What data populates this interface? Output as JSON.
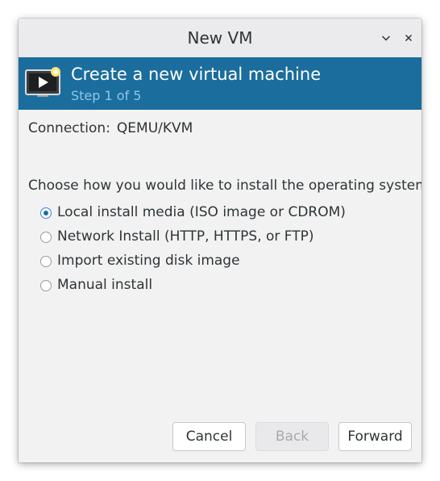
{
  "window": {
    "title": "New VM"
  },
  "titlebar": {
    "minimize_icon": "chevron-down-icon",
    "close_icon": "close-icon"
  },
  "banner": {
    "icon": "vm-monitor-icon",
    "title": "Create a new virtual machine",
    "step": "Step 1 of 5",
    "background_color": "#1b6d9d",
    "step_color": "#8cc6ea"
  },
  "connection": {
    "label": "Connection:",
    "value": "QEMU/KVM"
  },
  "install": {
    "prompt": "Choose how you would like to install the operating system",
    "options": [
      {
        "label": "Local install media (ISO image or CDROM)",
        "selected": true
      },
      {
        "label": "Network Install (HTTP, HTTPS, or FTP)",
        "selected": false
      },
      {
        "label": "Import existing disk image",
        "selected": false
      },
      {
        "label": "Manual install",
        "selected": false
      }
    ]
  },
  "buttons": {
    "cancel": "Cancel",
    "back": "Back",
    "back_enabled": false,
    "forward": "Forward"
  }
}
